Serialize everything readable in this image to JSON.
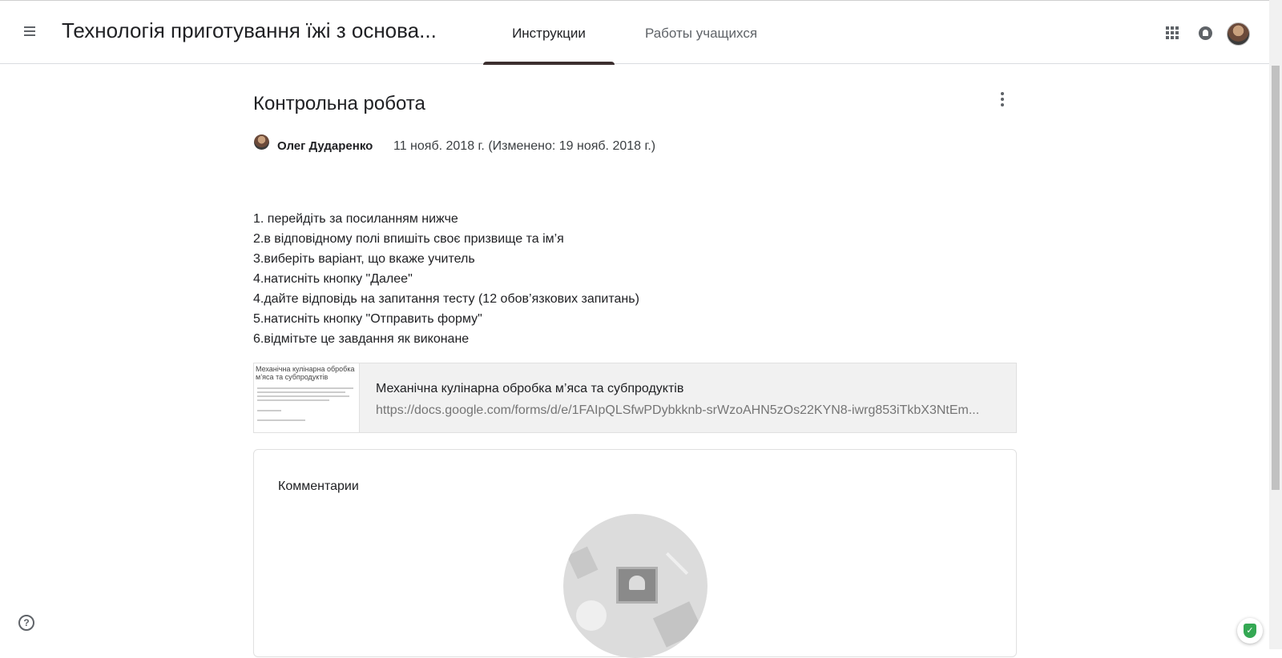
{
  "header": {
    "course_title": "Технологія приготування їжі з основа...",
    "tabs": [
      {
        "label": "Инструкции",
        "active": true
      },
      {
        "label": "Работы учащихся",
        "active": false
      }
    ]
  },
  "post": {
    "title": "Контрольна робота",
    "author": "Олег Дударенко",
    "date": "11 нояб. 2018 г. (Изменено: 19 нояб. 2018 г.)",
    "instructions": [
      "1. перейдіть за посиланням нижче",
      "2.в відповідному полі впишіть своє призвище та ім’я",
      "3.виберіть варіант, що вкаже учитель",
      "4.натисніть кнопку \"Далее\"",
      "4.дайте відповідь на запитання тесту (12 обов’язкових запитань)",
      "5.натисніть кнопку \"Отправить форму\"",
      "6.відмітьте це завдання як виконане"
    ],
    "attachment": {
      "title": "Механічна кулінарна обробка м’яса та субпродуктів",
      "url": "https://docs.google.com/forms/d/e/1FAIpQLSfwPDybkknb-srWzoAHN5zOs22KYN8-iwrg853iTkbX3NtEm...",
      "thumbnail_title": "Механічна кулінарна обробка м’яса та субпродуктів"
    }
  },
  "comments": {
    "title": "Комментарии"
  },
  "colors": {
    "tab_indicator": "#3c2f2f",
    "text": "#202124",
    "muted": "#5f6368",
    "shield": "#34a853"
  }
}
